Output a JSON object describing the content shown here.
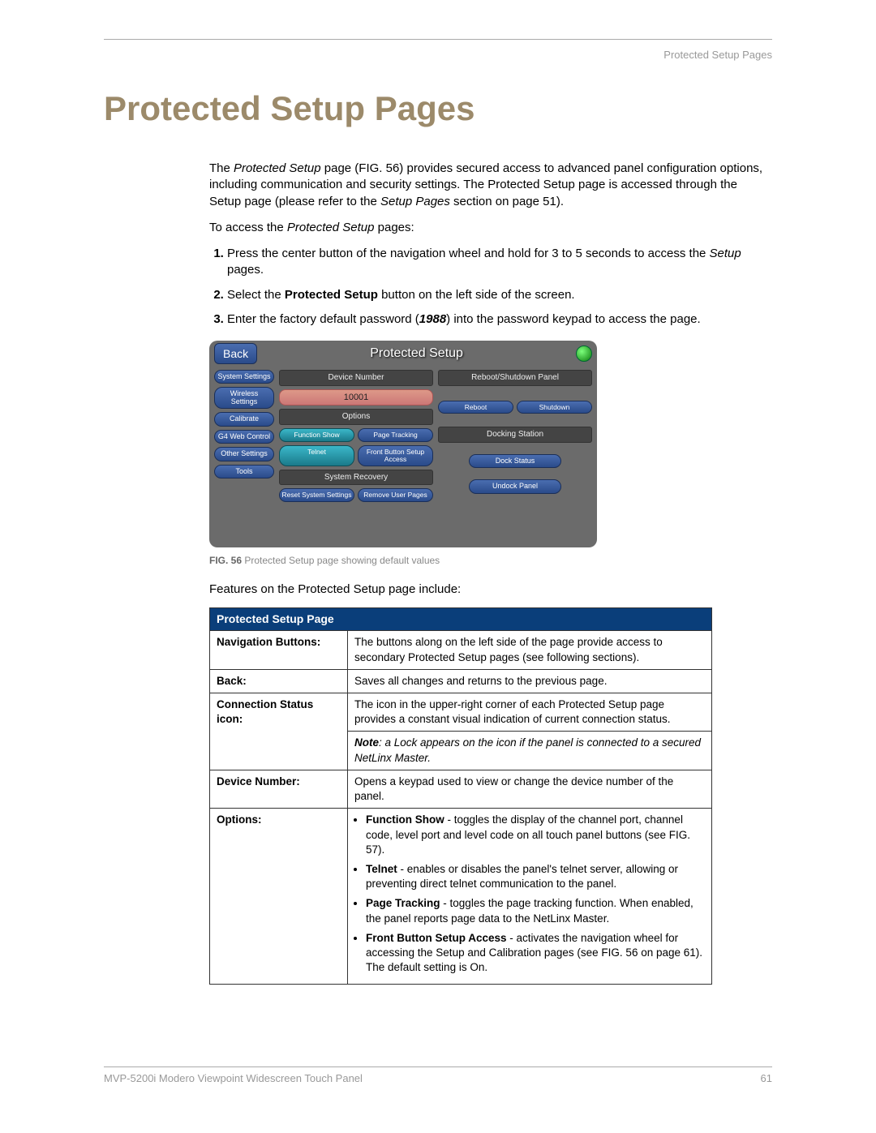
{
  "header": {
    "section": "Protected Setup Pages"
  },
  "title": "Protected Setup Pages",
  "intro": {
    "p1_a": "The ",
    "p1_b": "Protected Setup",
    "p1_c": " page (FIG. 56) provides secured access to advanced panel configuration options, including communication and security settings. The Protected Setup page is accessed through the Setup page (please refer to the ",
    "p1_d": "Setup Pages",
    "p1_e": " section on page 51).",
    "p2_a": "To access the ",
    "p2_b": "Protected Setup",
    "p2_c": " pages:"
  },
  "steps": {
    "s1_a": "Press the center button of the navigation wheel and hold for 3 to 5 seconds to access the ",
    "s1_b": "Setup",
    "s1_c": " pages.",
    "s2_a": "Select the ",
    "s2_b": "Protected Setup",
    "s2_c": " button on the left side of the screen.",
    "s3_a": "Enter the factory default password (",
    "s3_b": "1988",
    "s3_c": ") into the password keypad to access the page."
  },
  "screenshot": {
    "back": "Back",
    "title": "Protected Setup",
    "side": {
      "system": "System Settings",
      "wireless": "Wireless Settings",
      "calibrate": "Calibrate",
      "g4web": "G4 Web Control",
      "other": "Other Settings",
      "tools": "Tools"
    },
    "center": {
      "device_number_title": "Device Number",
      "device_number_value": "10001",
      "options_title": "Options",
      "function_show": "Function Show",
      "page_tracking": "Page Tracking",
      "telnet": "Telnet",
      "front_button": "Front Button Setup Access",
      "system_recovery_title": "System Recovery",
      "reset_system": "Reset System Settings",
      "remove_user": "Remove User Pages"
    },
    "right": {
      "reboot_shutdown_title": "Reboot/Shutdown Panel",
      "reboot": "Reboot",
      "shutdown": "Shutdown",
      "docking_title": "Docking Station",
      "dock_status": "Dock Status",
      "undock": "Undock Panel"
    }
  },
  "figure": {
    "prefix": "FIG. 56",
    "caption": "  Protected Setup page showing default values"
  },
  "features_intro": "Features on the Protected Setup page include:",
  "table": {
    "header": "Protected Setup Page",
    "rows": {
      "nav_label": "Navigation Buttons:",
      "nav_desc": "The buttons along on the left side of the page provide access to secondary Protected Setup pages (see following sections).",
      "back_label": "Back:",
      "back_desc": "Saves all changes and returns to the previous page.",
      "conn_label": "Connection Status icon:",
      "conn_desc": "The icon in the upper-right corner of each Protected Setup page provides a constant visual indication of current connection status.",
      "conn_note_label": "Note",
      "conn_note_text": ": a Lock appears on the icon if the panel is connected to a secured NetLinx Master.",
      "dev_label": "Device Number:",
      "dev_desc": "Opens a keypad used to view or change the device number of the panel.",
      "opt_label": "Options:",
      "opt1_b": "Function Show",
      "opt1_t": " - toggles the display of the channel port, channel code, level port and level code on all touch panel buttons (see FIG. 57).",
      "opt2_b": "Telnet",
      "opt2_t": " - enables or disables the panel's telnet server, allowing or preventing direct telnet communication to the panel.",
      "opt3_b": "Page Tracking",
      "opt3_t": " - toggles the page tracking function. When enabled, the panel reports page data to the NetLinx Master.",
      "opt4_b": "Front Button Setup Access",
      "opt4_t": " - activates the navigation wheel for accessing the Setup and Calibration pages (see FIG. 56 on page 61). The default setting is On."
    }
  },
  "footer": {
    "left": "MVP-5200i Modero Viewpoint Widescreen Touch Panel",
    "right": "61"
  }
}
